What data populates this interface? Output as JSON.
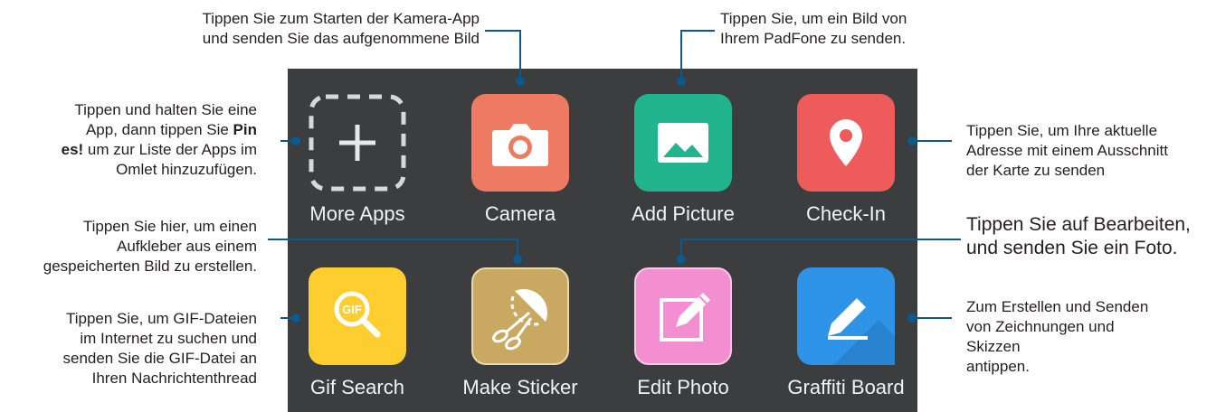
{
  "apps": [
    {
      "label": "More Apps",
      "icon": "plus-icon",
      "color": "transparent"
    },
    {
      "label": "Camera",
      "icon": "camera-icon",
      "color": "#ee7b61"
    },
    {
      "label": "Add Picture",
      "icon": "picture-icon",
      "color": "#22b38f"
    },
    {
      "label": "Check-In",
      "icon": "location-pin-icon",
      "color": "#ee5b5b"
    },
    {
      "label": "Gif Search",
      "icon": "gif-search-icon",
      "color": "#fdce2e"
    },
    {
      "label": "Make Sticker",
      "icon": "scissors-sticker-icon",
      "color": "#c9a961"
    },
    {
      "label": "Edit Photo",
      "icon": "pencil-edit-icon",
      "color": "#f38ed1"
    },
    {
      "label": "Graffiti Board",
      "icon": "graffiti-pen-icon",
      "color": "#2f93e8"
    }
  ],
  "notes": {
    "camera": {
      "l1": "Tippen Sie zum Starten der Kamera-App",
      "l2": "und senden Sie das aufgenommene Bild"
    },
    "add_picture": {
      "l1": "Tippen Sie, um ein Bild von",
      "l2": "Ihrem PadFone zu senden."
    },
    "more_apps": {
      "l1": "Tippen und halten Sie eine",
      "l2a": "App, dann tippen Sie ",
      "l2b": "Pin",
      "l3a": "es!",
      "l3b": " um zur Liste der Apps im",
      "l4": "Omlet hinzuzufügen."
    },
    "check_in": {
      "l1": "Tippen Sie, um Ihre aktuelle",
      "l2": "Adresse mit einem Ausschnitt",
      "l3": "der Karte zu senden"
    },
    "make_sticker": {
      "l1": "Tippen Sie hier, um einen",
      "l2": "Aufkleber aus einem",
      "l3": "gespeicherten Bild zu erstellen."
    },
    "edit_photo": {
      "l1": "Tippen Sie auf Bearbeiten,",
      "l2": "und senden Sie ein Foto."
    },
    "gif_search": {
      "l1": "Tippen Sie, um GIF-Dateien",
      "l2": "im Internet zu suchen und",
      "l3": "senden Sie die GIF-Datei an",
      "l4": "Ihren Nachrichtenthread"
    },
    "graffiti": {
      "l1": "Zum Erstellen und Senden",
      "l2": "von Zeichnungen und",
      "l3": "Skizzen",
      "l4": "antippen."
    }
  },
  "colors": {
    "panel": "#3b3d3f",
    "callout_line": "#0b5a8f"
  }
}
